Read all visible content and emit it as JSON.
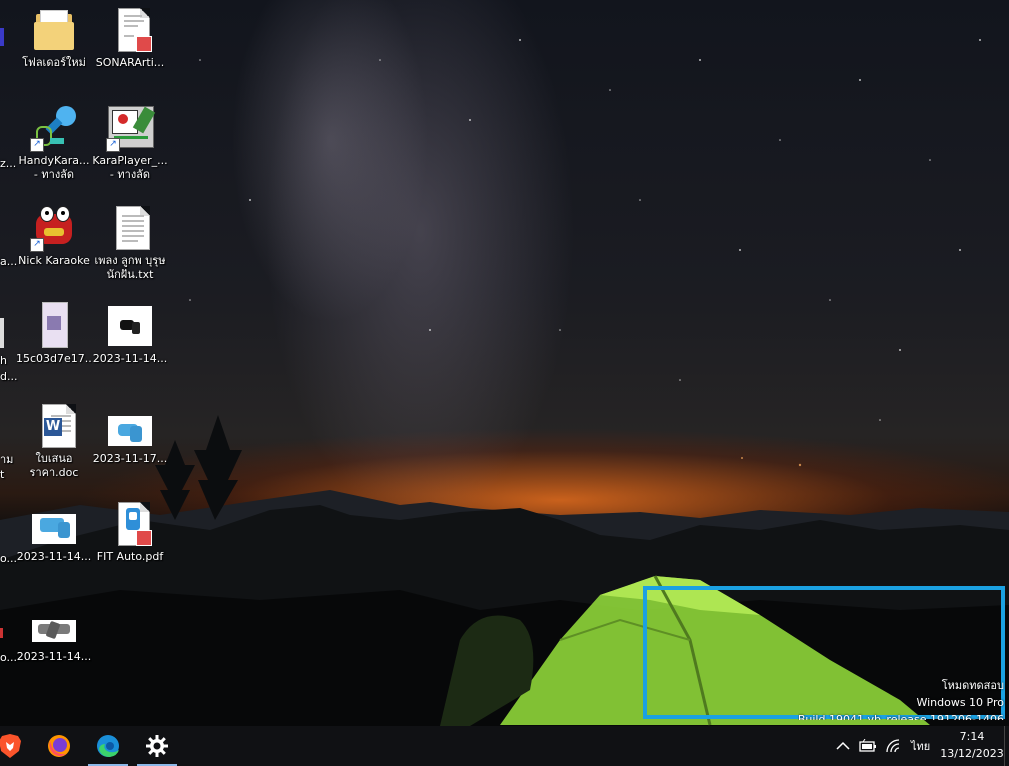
{
  "desktop": {
    "icons": [
      {
        "label": "โฟลเดอร์ใหม่",
        "icon": "folder-icon"
      },
      {
        "label": "SONARArti...",
        "icon": "pdf-document-icon"
      },
      {
        "label": "HandyKara... - ทางลัด",
        "icon": "microphone-app-icon"
      },
      {
        "label": "KaraPlayer_... - ทางลัด",
        "icon": "karaplayer-app-icon"
      },
      {
        "label": "Nick Karaoke",
        "icon": "nick-karaoke-app-icon"
      },
      {
        "label": "เพลง ลูกพ บุรุษนักฝัน.txt",
        "icon": "text-document-icon"
      },
      {
        "label": "15c03d7e17...",
        "icon": "image-file-icon"
      },
      {
        "label": "2023-11-14...",
        "icon": "image-file-icon"
      },
      {
        "label": "ใบเสนอ ราคา.doc",
        "icon": "word-document-icon"
      },
      {
        "label": "2023-11-17...",
        "icon": "image-file-icon"
      },
      {
        "label": "2023-11-14...",
        "icon": "image-file-icon"
      },
      {
        "label": "FIT Auto.pdf",
        "icon": "pdf-document-icon"
      },
      {
        "label": "2023-11-14...",
        "icon": "image-file-icon"
      }
    ],
    "clipped_labels": [
      "z...",
      "a...",
      "h",
      "d...",
      "าม",
      "t",
      "o...",
      "o..."
    ]
  },
  "watermark": {
    "line1": "โหมดทดสอบ",
    "line2": "Windows 10 Pro",
    "line3": "Build 19041.vb_release.191206-1406"
  },
  "taskbar": {
    "apps": [
      {
        "name": "brave-icon"
      },
      {
        "name": "firefox-icon"
      },
      {
        "name": "edge-icon"
      },
      {
        "name": "settings-gear-icon"
      }
    ],
    "tray": {
      "chevron": "^",
      "language": "ไทย"
    },
    "clock": {
      "time": "7:14",
      "date": "13/12/2023"
    }
  },
  "colors": {
    "highlight_border": "#1ba1e2",
    "taskbar_bg": "#101114",
    "tent_green": "#8fd63a"
  }
}
